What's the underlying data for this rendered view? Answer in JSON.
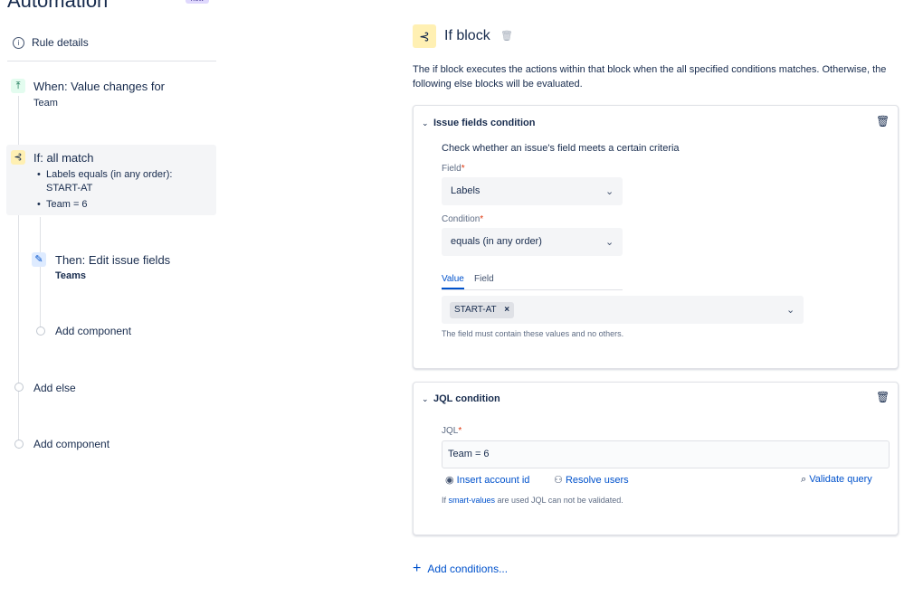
{
  "app": {
    "title": "Automation",
    "badge": "new"
  },
  "sidebar": {
    "rule_details": "Rule details",
    "when": {
      "title": "When: Value changes for",
      "sub": "Team"
    },
    "if": {
      "title": "If: all match",
      "conditions": [
        "Labels equals (in any order): START-AT",
        "Team = 6"
      ]
    },
    "then": {
      "title": "Then: Edit issue fields",
      "sub": "Teams"
    },
    "add_component_inner": "Add component",
    "add_else": "Add else",
    "add_component": "Add component"
  },
  "main": {
    "title": "If block",
    "description": "The if block executes the actions within that block when the all specified conditions matches. Otherwise, the following else blocks will be evaluated.",
    "issue_fields": {
      "title": "Issue fields condition",
      "subtitle": "Check whether an issue's field meets a certain criteria",
      "field_label": "Field",
      "field_value": "Labels",
      "condition_label": "Condition",
      "condition_value": "equals (in any order)",
      "tabs": [
        "Value",
        "Field"
      ],
      "active_tab": "Value",
      "tags": [
        "START-AT"
      ],
      "hint": "The field must contain these values and no others."
    },
    "jql": {
      "title": "JQL condition",
      "label": "JQL",
      "value": "Team = 6",
      "insert_account": "Insert account id",
      "resolve_users": "Resolve users",
      "validate": "Validate query",
      "hint_prefix": "If ",
      "hint_link": "smart-values",
      "hint_suffix": " are used JQL can not be validated."
    },
    "add_conditions": "Add conditions..."
  },
  "colors": {
    "accent": "#0052CC",
    "if_icon_bg": "#FFF0B3",
    "when_icon_bg": "#E3FCEF",
    "then_icon_bg": "#DEEBFF"
  }
}
